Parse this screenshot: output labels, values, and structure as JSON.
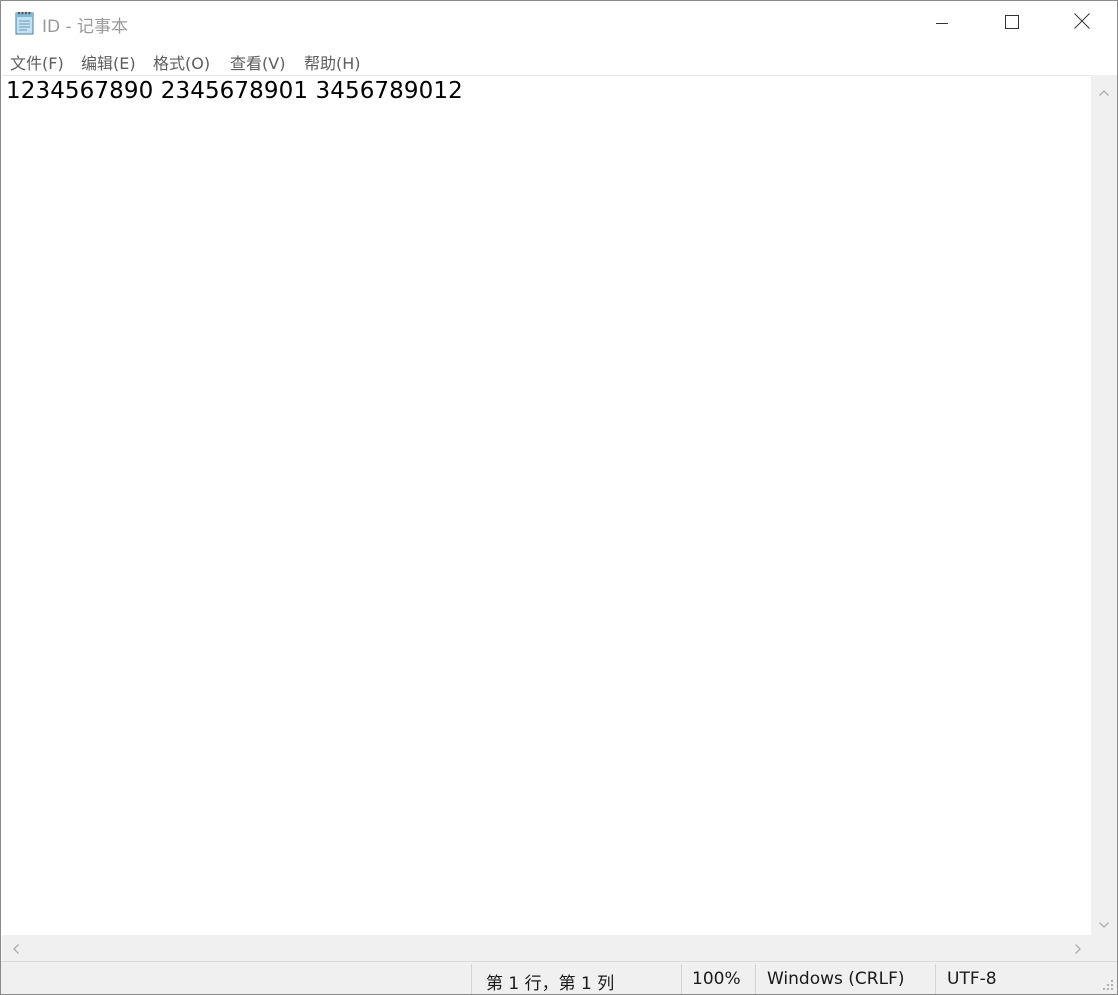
{
  "window": {
    "title": "ID - 记事本",
    "icon": "notepad-icon"
  },
  "title_buttons": {
    "minimize": "minimize-icon",
    "maximize": "maximize-icon",
    "close": "close-icon"
  },
  "menu": {
    "items": [
      {
        "label": "文件(F)"
      },
      {
        "label": "编辑(E)"
      },
      {
        "label": "格式(O)"
      },
      {
        "label": "查看(V)"
      },
      {
        "label": "帮助(H)"
      }
    ]
  },
  "editor": {
    "content": "1234567890 2345678901 3456789012"
  },
  "statusbar": {
    "position": "第 1 行，第 1 列",
    "zoom": "100%",
    "line_ending": "Windows (CRLF)",
    "encoding": "UTF-8"
  },
  "colors": {
    "title_text": "#9a9a9a",
    "menu_text": "#5e5e5e",
    "scrollbar_bg": "#f0f0f0",
    "statusbar_bg": "#f0f0f0"
  }
}
